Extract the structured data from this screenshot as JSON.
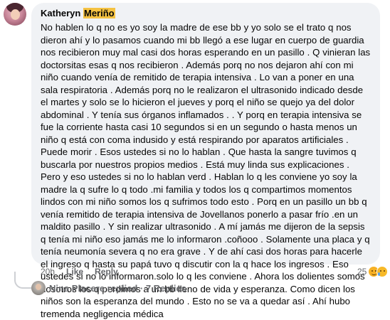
{
  "comment": {
    "author_first": "Katheryn",
    "author_last": "Meriño",
    "text": "No hablen lo q no es yo soy la madre de ese bb y yo solo se el trato q nos dieron ahí y lo pasamos cuando mi bb llegó a ese lugar en cuerpo de guardia nos recibieron muy mal casi dos horas esperando en un pasillo . Q vinieran las doctorsitas esas q nos recibieron . Además porq no nos dejaron ahí con mi niño cuando venía de remitido de terapia intensiva . Lo van a poner en una sala respiratoria . Además porq no le realizaron el ultrasonido indicado desde el martes y solo se lo hicieron el jueves y porq el niño se quejo ya del dolor abdominal . Y tenía sus órganos inflamados . . Y porq en terapia intensiva se fue la corriente hasta casi 10 segundos si en un segundo o hasta menos un niño q está con coma indusido y está respirando por aparatos artificiales . Puede morir . Esos ustedes si no lo hablan . Que hasta la sangre tuvimos q buscarla por nuestros propios medios . Está muy linda sus explicaciones . Pero y eso ustedes si no lo hablan verd . Hablan lo q les conviene yo soy la madre la q sufre lo q todo .mi familia y todos los q compartimos momentos lindos con mi niño somos los q sufrimos todo esto . Porq en un pasillo un bb q venía remitido de terapia intensiva de Jovellanos ponerlo a pasar frío .en un maldito pasillo . Y sin realizar ultrasonido . A mí jamás me dijeron de la sepsis q tenía mi niño eso jamás me lo informaron .coñooo . Solamente una placa y q tenía neumonía severa q no era grave . Y de ahí casi dos horas para hacerle el ingreso q hasta su papá tuvo q discutir con la q hace los ingresos . Eso ustedes si no lo informaron.solo lo q les conviene . Ahora los dolientes somos nosotros los q perdimos a un bb lleno de vida y esperanza. Como dicen los niños son la esperanza del mundo . Esto no se va a quedar así . Ahí hubo tremenda negligencia médica"
  },
  "actions": {
    "time": "20h",
    "like_label": "Like",
    "reply_label": "Reply"
  },
  "reactions": {
    "count": "25",
    "icons": [
      "care-emoji-icon",
      "sad-emoji-icon"
    ]
  },
  "replies": {
    "label": "Nina Placere replied · 7 Replies"
  },
  "colors": {
    "bubble": "#f0f2f5",
    "name_highlight": "#f5c242",
    "meta_text": "#65676b"
  }
}
